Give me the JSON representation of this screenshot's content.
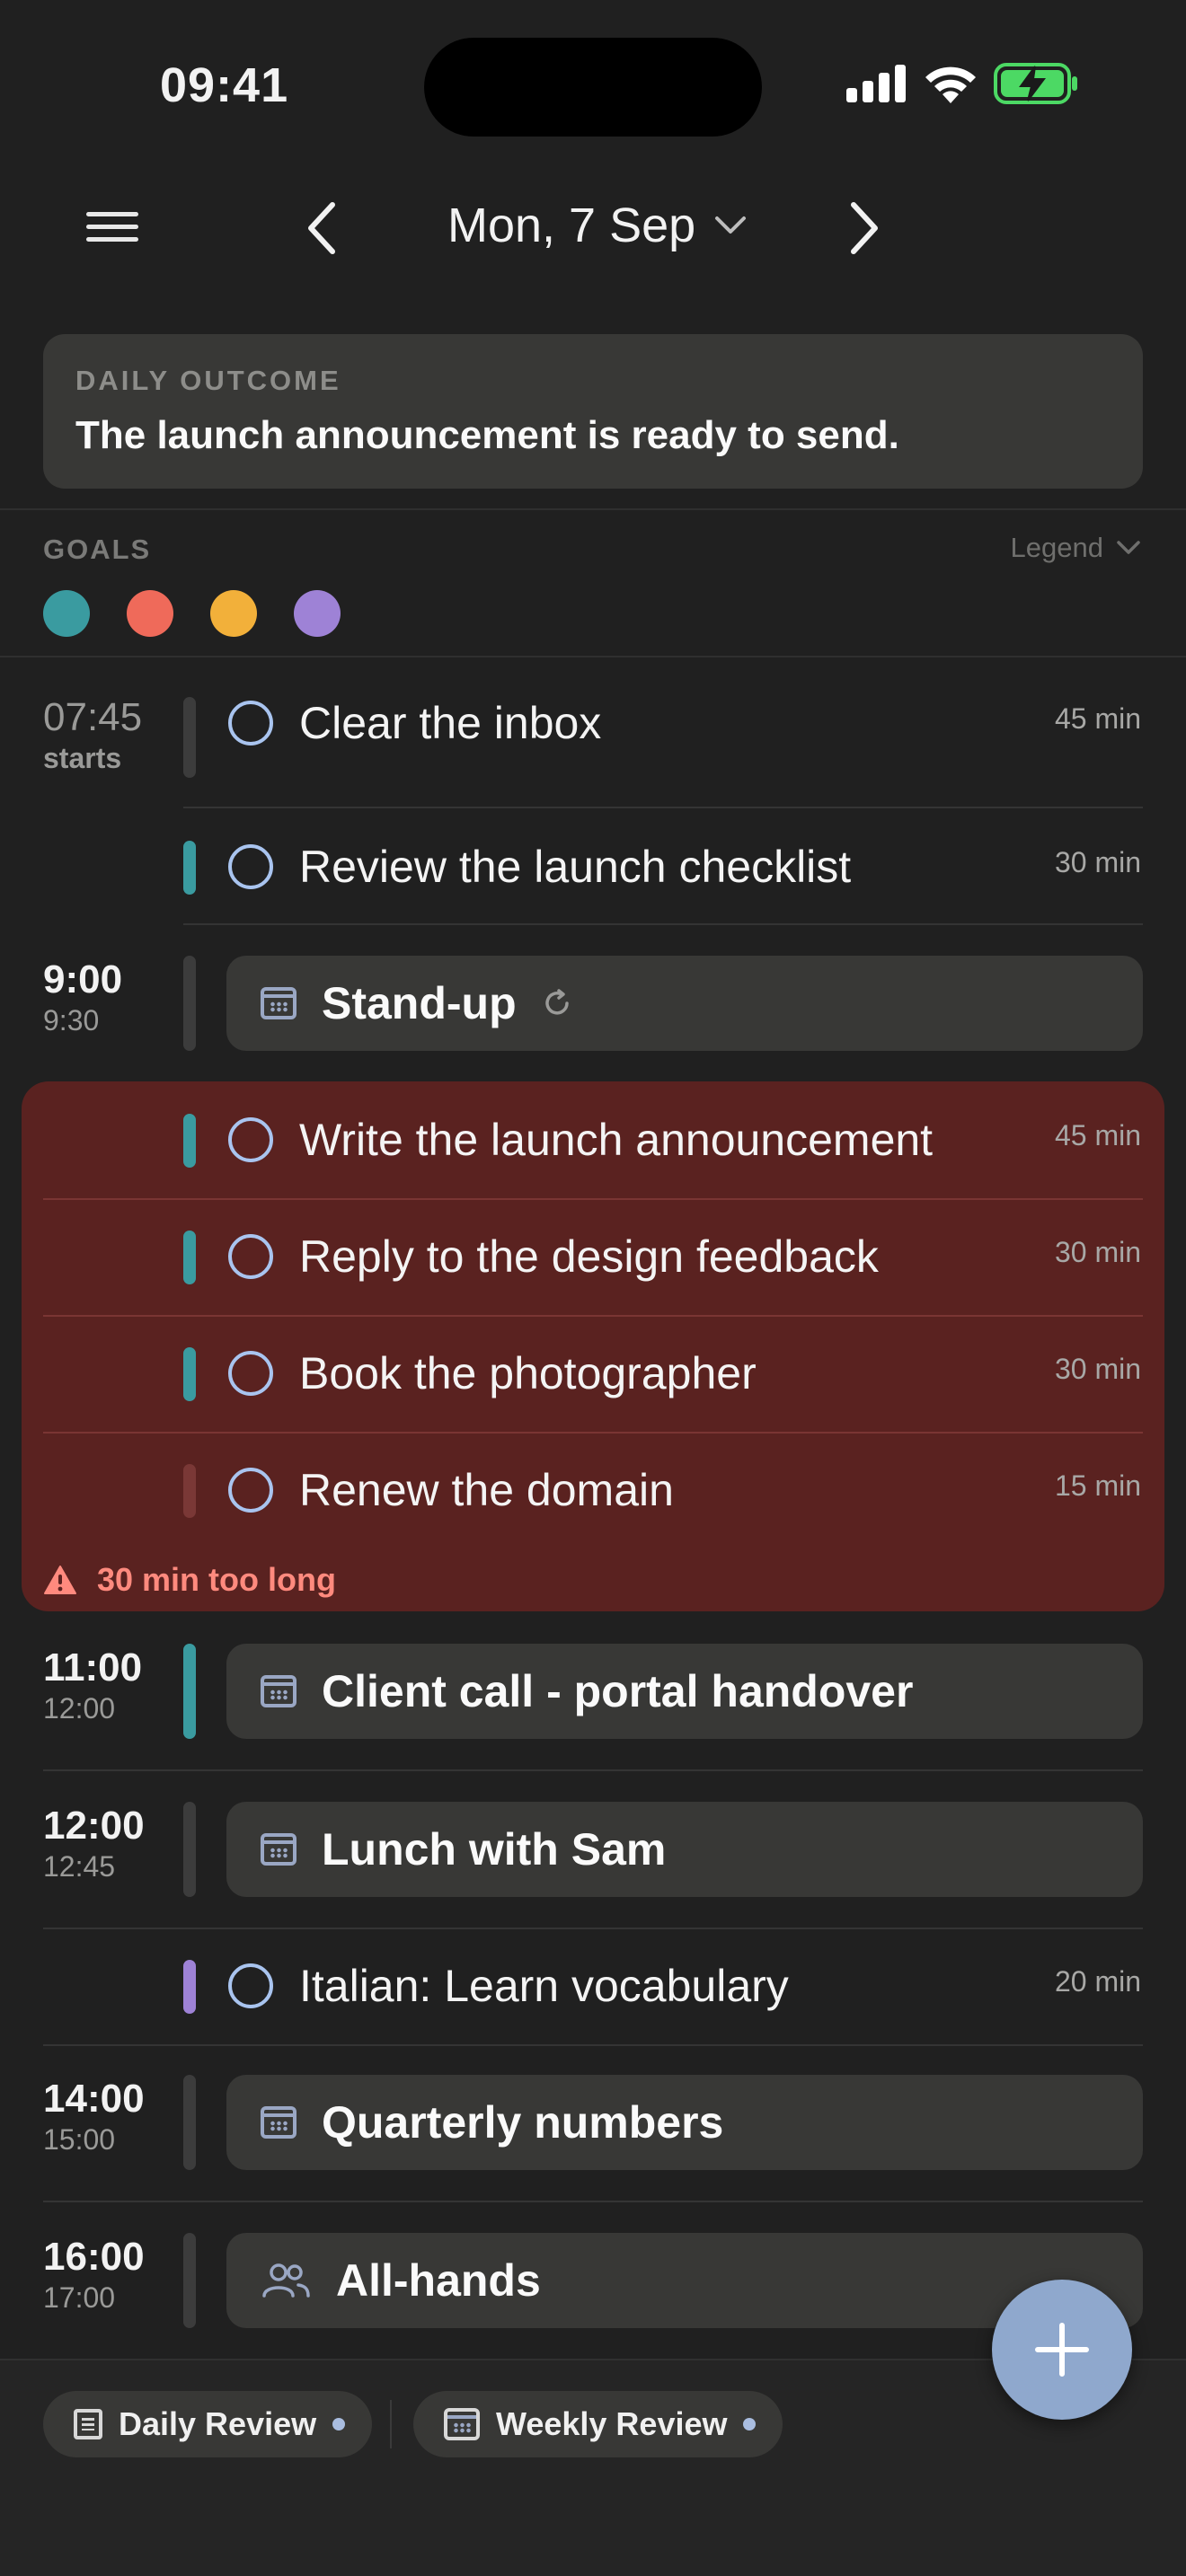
{
  "status": {
    "time": "09:41"
  },
  "header": {
    "date_label": "Mon, 7 Sep"
  },
  "outcome": {
    "label": "DAILY OUTCOME",
    "text": "The launch announcement is ready to send."
  },
  "goals": {
    "label": "GOALS",
    "legend_label": "Legend",
    "colors": [
      "#3a9ba0",
      "#ef6a5a",
      "#f2b03a",
      "#9e82d6"
    ]
  },
  "timeline": {
    "inbox": {
      "time": "07:45",
      "sub": "starts",
      "title": "Clear the inbox",
      "duration": "45 min"
    },
    "checklist": {
      "title": "Review the launch checklist",
      "duration": "30 min"
    },
    "standup": {
      "time": "9:00",
      "end": "9:30",
      "title": "Stand-up"
    },
    "announce": {
      "title": "Write the launch announcement",
      "duration": "45 min"
    },
    "feedback": {
      "title": "Reply to the design feedback",
      "duration": "30 min"
    },
    "photographer": {
      "title": "Book the photographer",
      "duration": "30 min"
    },
    "domain": {
      "title": "Renew the domain",
      "duration": "15 min"
    },
    "warning": "30 min too long",
    "client": {
      "time": "11:00",
      "end": "12:00",
      "title": "Client call - portal handover"
    },
    "lunch": {
      "time": "12:00",
      "end": "12:45",
      "title": "Lunch with Sam"
    },
    "italian": {
      "title": "Italian: Learn vocabulary",
      "duration": "20 min"
    },
    "quarterly": {
      "time": "14:00",
      "end": "15:00",
      "title": "Quarterly numbers"
    },
    "allhands": {
      "time": "16:00",
      "end": "17:00",
      "title": "All-hands"
    }
  },
  "bottom": {
    "daily_review": "Daily Review",
    "weekly_review": "Weekly Review"
  }
}
